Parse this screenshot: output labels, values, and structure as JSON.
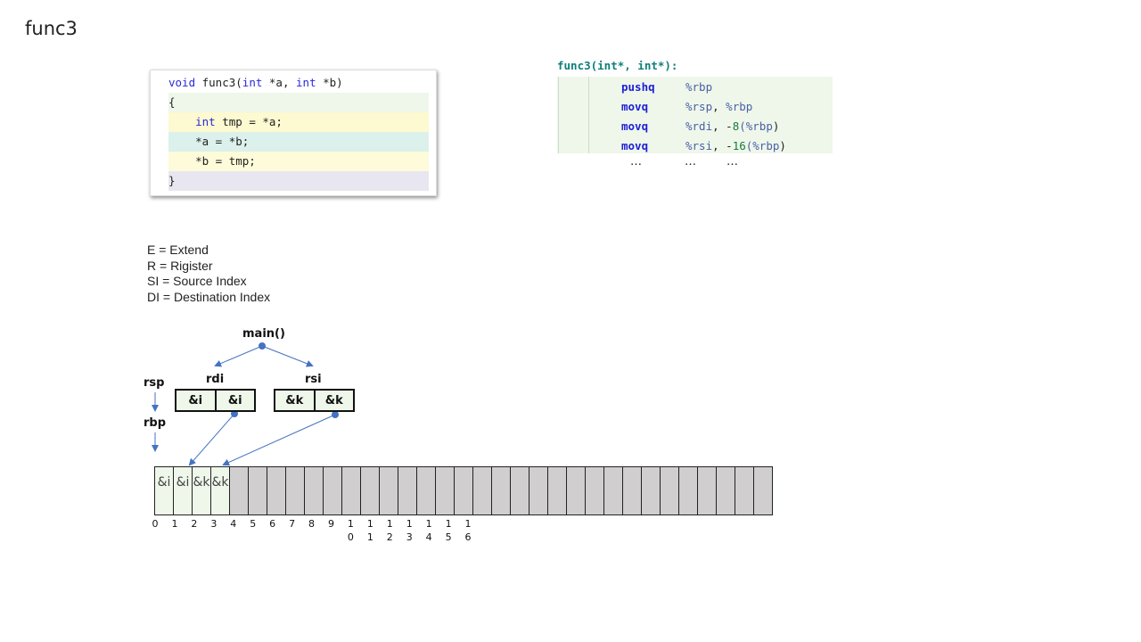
{
  "slide_title": "func3",
  "c_code": {
    "lines": [
      {
        "kw": "void",
        "rest": " func3(",
        "kw2": "int",
        "rest2": " *a, ",
        "kw3": "int",
        "rest3": " *b)"
      },
      {
        "text": "{"
      },
      {
        "indent": "    ",
        "kw": "int",
        "rest": " tmp = *a;"
      },
      {
        "text": "    *a = *b;"
      },
      {
        "text": "    *b = tmp;"
      },
      {
        "text": "}"
      }
    ]
  },
  "asm": {
    "title": "func3(int*, int*):",
    "rows": [
      {
        "mnemonic": "pushq",
        "op1": "%rbp",
        "sep": "",
        "num": "",
        "op2": "",
        "close": ""
      },
      {
        "mnemonic": "movq",
        "op1": "%rsp",
        "sep": ", ",
        "num": "",
        "op2": "%rbp",
        "close": ""
      },
      {
        "mnemonic": "movq",
        "op1": "%rdi",
        "sep": ", -",
        "num": "8",
        "op2": "(%rbp",
        "close": ")"
      },
      {
        "mnemonic": "movq",
        "op1": "%rsi",
        "sep": ", -",
        "num": "16",
        "op2": "(%rbp",
        "close": ")"
      }
    ],
    "ellipsis": [
      "…",
      "…",
      "…"
    ]
  },
  "legend": [
    "E = Extend",
    "R = Rigister",
    "SI = Source Index",
    "DI = Destination Index"
  ],
  "diagram": {
    "caller": "main()",
    "rsp_label": "rsp",
    "rbp_label": "rbp",
    "rdi": {
      "label": "rdi",
      "cells": [
        "&i",
        "&i"
      ]
    },
    "rsi": {
      "label": "rsi",
      "cells": [
        "&k",
        "&k"
      ]
    },
    "memory": {
      "cells": [
        "&i",
        "&i",
        "&k",
        "&k",
        "",
        "",
        "",
        "",
        "",
        "",
        "",
        "",
        "",
        "",
        "",
        "",
        "",
        "",
        "",
        "",
        "",
        "",
        "",
        "",
        "",
        "",
        "",
        "",
        "",
        "",
        "",
        "",
        ""
      ],
      "indices": [
        "0",
        "1",
        "2",
        "3",
        "4",
        "5",
        "6",
        "7",
        "8",
        "9",
        "10",
        "11",
        "12",
        "13",
        "14",
        "15",
        "16"
      ]
    },
    "colors": {
      "used": "#eef7ea",
      "free": "#d0cecf",
      "arrow": "#4472c4"
    }
  }
}
